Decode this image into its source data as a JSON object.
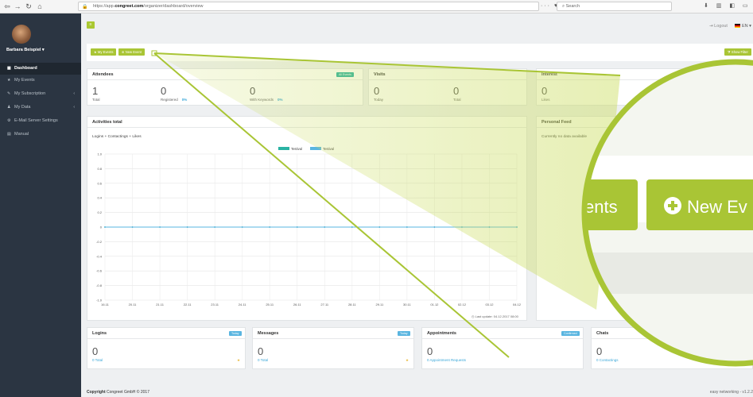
{
  "browser": {
    "url_prefix": "https://app.",
    "url_domain": "congreet.com",
    "url_path": "/organizer/dashboard/overview",
    "page_actions": "··· ♥ ☆",
    "search_placeholder": "Search"
  },
  "user": {
    "name": "Barbara Beispiel ▾"
  },
  "sidebar": {
    "items": [
      {
        "label": "Dashboard",
        "icon": "dashboard-icon"
      },
      {
        "label": "My Events",
        "icon": "star-icon"
      },
      {
        "label": "My Subscription",
        "icon": "edit-icon"
      },
      {
        "label": "My Data",
        "icon": "user-icon"
      },
      {
        "label": "E-Mail Server Settings",
        "icon": "gears-icon"
      },
      {
        "label": "Manual",
        "icon": "book-icon"
      }
    ]
  },
  "topbar": {
    "logout": "Logout",
    "lang": "EN ▾"
  },
  "actions": {
    "my_events": "My Events",
    "new_event": "New Event",
    "show_filter": "Show Filter"
  },
  "attendees": {
    "title": "Attendees",
    "badge": "All Events",
    "total_value": "1",
    "total_label": "Total",
    "registered_value": "0",
    "registered_label": "Registered",
    "registered_pct": "0%",
    "keywords_value": "0",
    "keywords_label": "With Keywords",
    "keywords_pct": "0%"
  },
  "visits": {
    "title": "Visits",
    "today_value": "0",
    "today_label": "Today",
    "total_value": "0",
    "total_label": "Total"
  },
  "interest": {
    "title": "Interest",
    "likes_value": "0",
    "likes_label": "Likes"
  },
  "activities": {
    "title": "Activities total",
    "subtitle": "Logins + Contactings + Likes",
    "last_update": "Last update: 04.12.2017 08:00"
  },
  "feed": {
    "title": "Personal Feed",
    "empty": "Currently no data available"
  },
  "chart_data": {
    "type": "line",
    "x": [
      "16.11",
      "20.11",
      "21.11",
      "22.11",
      "23.11",
      "24.11",
      "25.11",
      "26.11",
      "27.11",
      "28.11",
      "29.11",
      "30.11",
      "01.12",
      "02.12",
      "03.12",
      "04.12"
    ],
    "series": [
      {
        "name": "Testival",
        "values": [
          0,
          0,
          0,
          0,
          0,
          0,
          0,
          0,
          0,
          0,
          0,
          0,
          0,
          0,
          0,
          0
        ],
        "color": "#2ab3a3"
      },
      {
        "name": "Testival",
        "values": [
          0,
          0,
          0,
          0,
          0,
          0,
          0,
          0,
          0,
          0,
          0,
          0,
          0,
          0,
          0,
          0
        ],
        "color": "#5ab5e0"
      }
    ],
    "y_ticks": [
      "1.0",
      "0.8",
      "0.6",
      "0.4",
      "0.2",
      "0",
      "-0.2",
      "-0.4",
      "-0.6",
      "-0.8",
      "-1.0"
    ],
    "ylim": [
      -1.0,
      1.0
    ],
    "grid": true,
    "legend": "top-center"
  },
  "bottom": {
    "logins": {
      "title": "Logins",
      "badge": "Today",
      "value": "0",
      "label": "0 Total"
    },
    "messages": {
      "title": "Messages",
      "badge": "Today",
      "value": "0",
      "label": "0 Total"
    },
    "appointments": {
      "title": "Appointments",
      "badge": "Confirmed",
      "value": "0",
      "label": "0 Appointment Requests"
    },
    "chats": {
      "title": "Chats",
      "value": "0",
      "label": "0 Contactings"
    }
  },
  "zoom": {
    "btn1_text": "ents",
    "btn2_text": "New Ev"
  },
  "footer": {
    "copyright_bold": "Copyright",
    "copyright_rest": " Congreet GmbH © 2017",
    "version": "easy networking - v1.2.2"
  },
  "colors": {
    "brand_green": "#a9c535",
    "sidebar": "#2b3542",
    "badge_blue": "#5ab5e0",
    "line_teal": "#2ab3a3"
  }
}
